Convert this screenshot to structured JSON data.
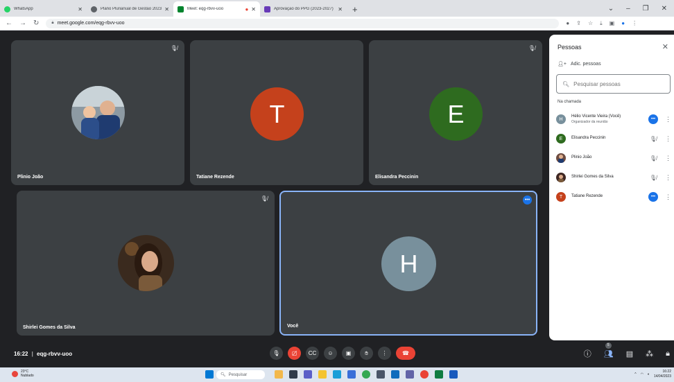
{
  "browser": {
    "tabs": [
      {
        "label": "WhatsApp",
        "favicon_color": "#25d366",
        "active": false
      },
      {
        "label": "Plano Plurianual de Gestão 2023",
        "favicon_color": "#5f6368",
        "active": false
      },
      {
        "label": "Meet: eqg-rbvv-uoo",
        "favicon_color": "#00832d",
        "active": true
      },
      {
        "label": "Aprovação do PPG (2023-2027)",
        "favicon_color": "#673ab7",
        "active": false
      }
    ],
    "url": "meet.google.com/eqg-rbvv-uoo"
  },
  "stage": {
    "tiles": [
      {
        "name": "Plinio João",
        "kind": "photo",
        "muted": true
      },
      {
        "name": "Tatiane Rezende",
        "kind": "letter",
        "letter": "T",
        "color": "#c5411c",
        "muted": false
      },
      {
        "name": "Elisandra Peccinin",
        "kind": "letter",
        "letter": "E",
        "color": "#2e6b1f",
        "muted": true
      },
      {
        "name": "Shirlei Gomes da Silva",
        "kind": "photo",
        "muted": true
      },
      {
        "name": "Você",
        "kind": "letter",
        "letter": "H",
        "color": "#78909c",
        "muted": false
      }
    ]
  },
  "bottombar": {
    "time": "16:22",
    "separator": "|",
    "meeting_code": "eqg-rbvv-uoo",
    "participant_count": "5"
  },
  "panel": {
    "title": "Pessoas",
    "add_people": "Adic. pessoas",
    "search_placeholder": "Pesquisar pessoas",
    "section": "Na chamada",
    "people": [
      {
        "name": "Hélio Vicente Vieira (Você)",
        "subtitle": "Organizador da reunião",
        "avatar": "H",
        "avatar_color": "#78909c",
        "status": "speaking"
      },
      {
        "name": "Elisandra Peccinin",
        "subtitle": "",
        "avatar": "E",
        "avatar_color": "#2e6b1f",
        "status": "muted"
      },
      {
        "name": "Plinio João",
        "subtitle": "",
        "avatar": "",
        "avatar_color": "#6d4c41",
        "status": "muted"
      },
      {
        "name": "Shirlei Gomes da Silva",
        "subtitle": "",
        "avatar": "",
        "avatar_color": "#3e2723",
        "status": "muted"
      },
      {
        "name": "Tatiane Rezende",
        "subtitle": "",
        "avatar": "T",
        "avatar_color": "#c5411c",
        "status": "speaking"
      }
    ]
  },
  "taskbar": {
    "temperature": "23°C",
    "weather": "Nublado",
    "search": "Pesquisar",
    "time": "16:22",
    "date": "14/04/2023"
  }
}
